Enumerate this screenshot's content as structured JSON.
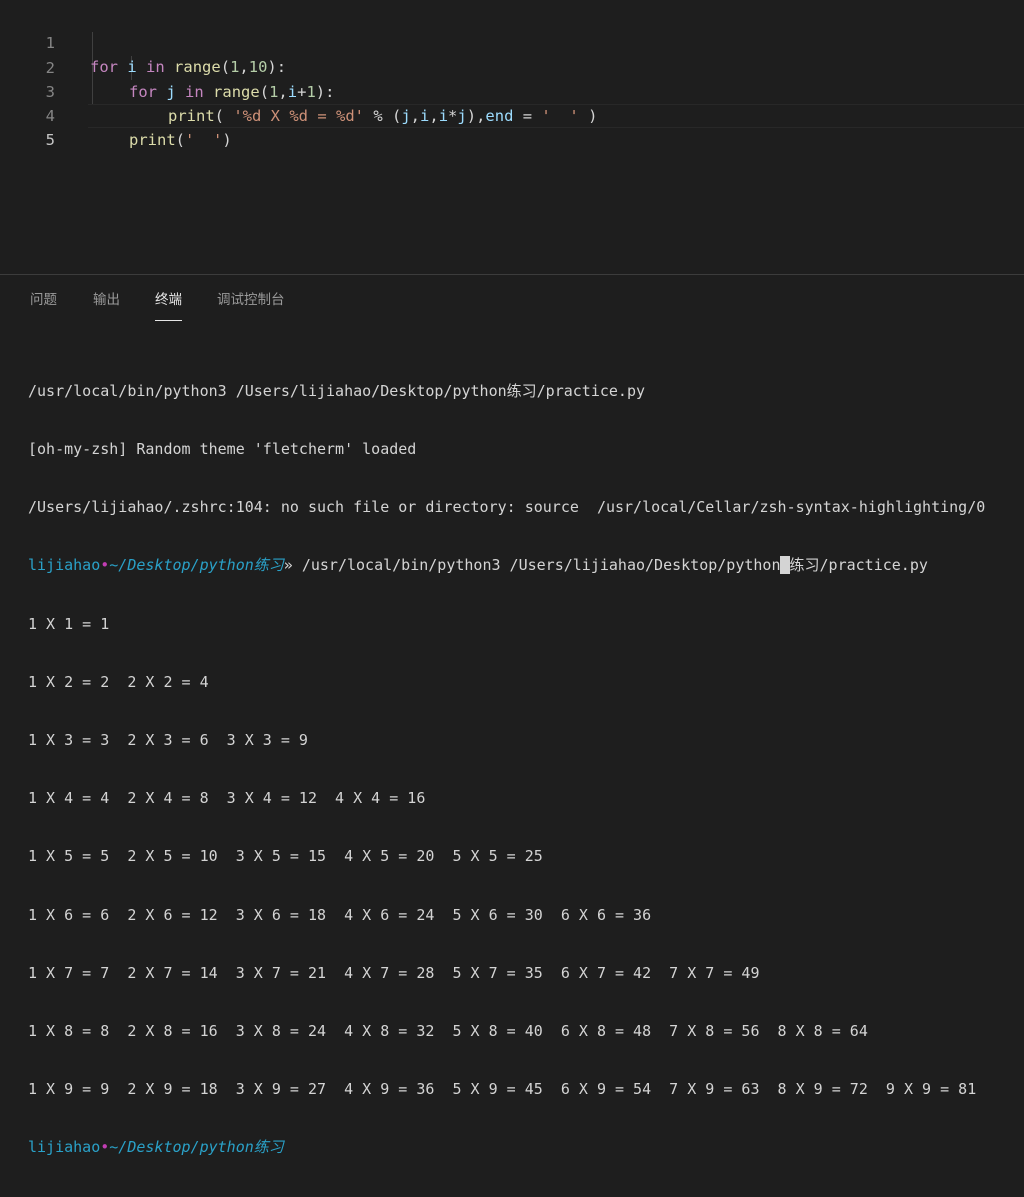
{
  "editor": {
    "lines": [
      {
        "number": "1"
      },
      {
        "number": "2"
      },
      {
        "number": "3"
      },
      {
        "number": "4"
      },
      {
        "number": "5"
      }
    ],
    "tokens": {
      "l1_for": "for",
      "l1_i": "i",
      "l1_in": "in",
      "l1_range": "range",
      "l1_open": "(",
      "l1_1": "1",
      "l1_comma": ",",
      "l1_10": "10",
      "l1_close": "):",
      "l2_for": "for",
      "l2_j": "j",
      "l2_in": "in",
      "l2_range": "range",
      "l2_open": "(",
      "l2_1": "1",
      "l2_comma": ",",
      "l2_i": "i",
      "l2_plus": "+",
      "l2_1b": "1",
      "l2_close": "):",
      "l3_print": "print",
      "l3_open": "( ",
      "l3_str": "'%d X %d = %d'",
      "l3_pct": " % (",
      "l3_j": "j",
      "l3_c1": ",",
      "l3_i": "i",
      "l3_c2": ",",
      "l3_i2": "i",
      "l3_mul": "*",
      "l3_j2": "j",
      "l3_c3": "),",
      "l3_end": "end",
      "l3_eq": " = ",
      "l3_str2": "'  '",
      "l3_close": " )",
      "l4_print": "print",
      "l4_open": "(",
      "l4_str": "'  '",
      "l4_close": ")"
    }
  },
  "panel": {
    "tabs": [
      "问题",
      "输出",
      "终端",
      "调试控制台"
    ],
    "active_tab": "终端"
  },
  "terminal": {
    "line1": "/usr/local/bin/python3 /Users/lijiahao/Desktop/python练习/practice.py",
    "line2": "[oh-my-zsh] Random theme 'fletcherm' loaded",
    "line3": "/Users/lijiahao/.zshrc:104: no such file or directory: source  /usr/local/Cellar/zsh-syntax-highlighting/0",
    "prompt_user": "lijiahao",
    "prompt_dot": "•",
    "prompt_path": "~/Desktop/python练习",
    "prompt_arrow": "» ",
    "command_a": "/usr/local/bin/python3 /Users/lijiahao/Desktop/python",
    "command_cursor": " ",
    "command_b": "练习/practice.py",
    "output": [
      "1 X 1 = 1",
      "1 X 2 = 2  2 X 2 = 4",
      "1 X 3 = 3  2 X 3 = 6  3 X 3 = 9",
      "1 X 4 = 4  2 X 4 = 8  3 X 4 = 12  4 X 4 = 16",
      "1 X 5 = 5  2 X 5 = 10  3 X 5 = 15  4 X 5 = 20  5 X 5 = 25",
      "1 X 6 = 6  2 X 6 = 12  3 X 6 = 18  4 X 6 = 24  5 X 6 = 30  6 X 6 = 36",
      "1 X 7 = 7  2 X 7 = 14  3 X 7 = 21  4 X 7 = 28  5 X 7 = 35  6 X 7 = 42  7 X 7 = 49",
      "1 X 8 = 8  2 X 8 = 16  3 X 8 = 24  4 X 8 = 32  5 X 8 = 40  6 X 8 = 48  7 X 8 = 56  8 X 8 = 64",
      "1 X 9 = 9  2 X 9 = 18  3 X 9 = 27  4 X 9 = 36  5 X 9 = 45  6 X 9 = 54  7 X 9 = 63  8 X 9 = 72  9 X 9 = 81"
    ],
    "last_prompt_user": "lijiahao",
    "last_prompt_dot": "•",
    "last_prompt_path": "~/Desktop/python练习"
  },
  "colors": {
    "background": "#1e1e1e",
    "keyword": "#c586c0",
    "function": "#dcdcaa",
    "variable": "#9cdcfe",
    "number": "#b5cea8",
    "string": "#ce9178",
    "prompt": "#2aa1c8",
    "prompt_dot": "#c23db4"
  }
}
